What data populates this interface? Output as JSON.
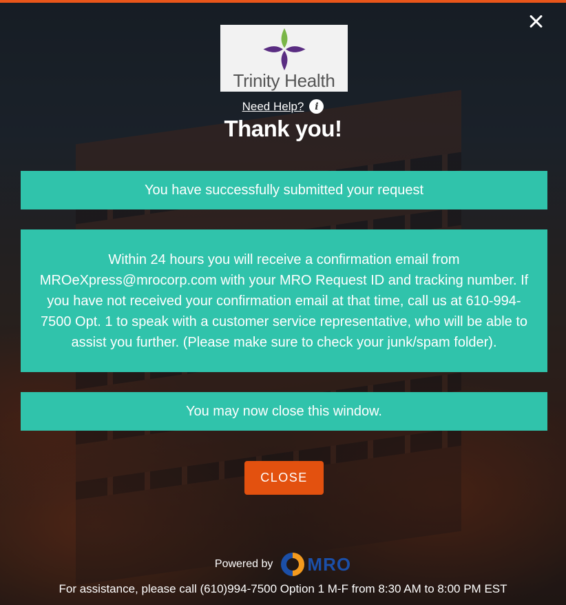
{
  "header": {
    "logo_text": "Trinity Health",
    "help_link": "Need Help?",
    "title": "Thank you!"
  },
  "messages": {
    "success": "You have successfully submitted your request",
    "details": "Within 24 hours you will receive a confirmation email from MROeXpress@mrocorp.com with your MRO Request ID and tracking number. If you have not received your confirmation email at that time, call us at 610-994-7500 Opt. 1 to speak with a customer service representative, who will be able to assist you further. (Please make sure to check your junk/spam folder).",
    "close_notice": "You may now close this window."
  },
  "actions": {
    "close_label": "CLOSE"
  },
  "footer": {
    "powered_by": "Powered by",
    "brand": "MRO",
    "assistance": "For assistance, please call (610)994-7500 Option 1 M-F from 8:30 AM to 8:00 PM EST"
  },
  "icons": {
    "close": "close-icon",
    "info": "info-icon",
    "logo": "trinity-health-logo",
    "mro": "mro-logo"
  },
  "colors": {
    "accent_bar": "#e8561a",
    "panel": "#30c3ab",
    "button": "#e3510f",
    "mro_blue": "#1b4fa8",
    "mro_orange": "#f39a1e"
  }
}
